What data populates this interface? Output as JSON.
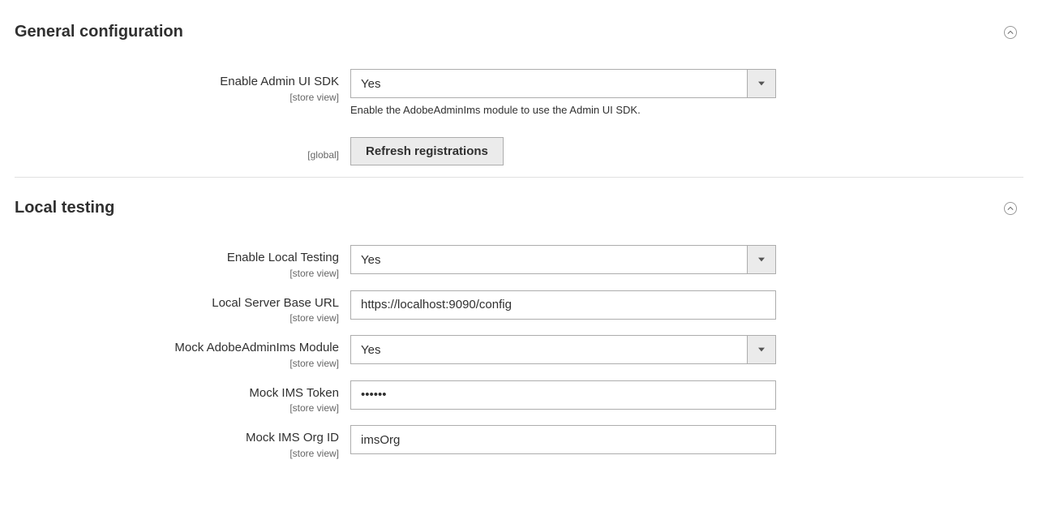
{
  "general": {
    "title": "General configuration",
    "fields": {
      "enable_sdk": {
        "label": "Enable Admin UI SDK",
        "scope": "[store view]",
        "value": "Yes",
        "help": "Enable the AdobeAdminIms module to use the Admin UI SDK."
      },
      "refresh": {
        "scope": "[global]",
        "button": "Refresh registrations"
      }
    }
  },
  "local": {
    "title": "Local testing",
    "fields": {
      "enable_local": {
        "label": "Enable Local Testing",
        "scope": "[store view]",
        "value": "Yes"
      },
      "base_url": {
        "label": "Local Server Base URL",
        "scope": "[store view]",
        "value": "https://localhost:9090/config"
      },
      "mock_module": {
        "label": "Mock AdobeAdminIms Module",
        "scope": "[store view]",
        "value": "Yes"
      },
      "mock_token": {
        "label": "Mock IMS Token",
        "scope": "[store view]",
        "value": "••••••"
      },
      "mock_org": {
        "label": "Mock IMS Org ID",
        "scope": "[store view]",
        "value": "imsOrg"
      }
    }
  }
}
